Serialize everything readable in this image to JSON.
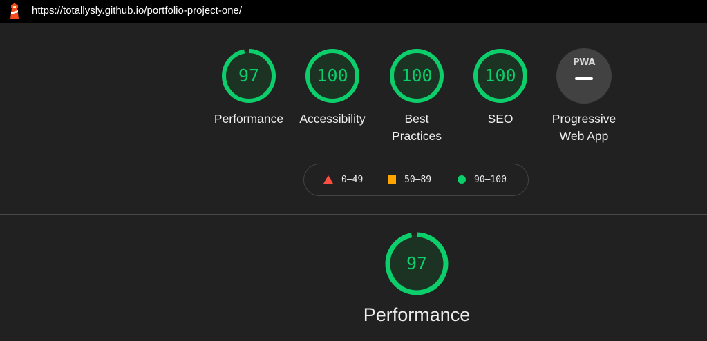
{
  "browser": {
    "url": "https://totallysly.github.io/portfolio-project-one/"
  },
  "colors": {
    "pass": "#0cce6b",
    "average": "#ffa400",
    "fail": "#ff4e42",
    "background": "#212121"
  },
  "gauges": [
    {
      "label": "Performance",
      "score": "97"
    },
    {
      "label": "Accessibility",
      "score": "100"
    },
    {
      "label": "Best Practices",
      "score": "100"
    },
    {
      "label": "SEO",
      "score": "100"
    }
  ],
  "pwa": {
    "badge": "PWA",
    "label": "Progressive Web App"
  },
  "legend": [
    {
      "range": "0–49",
      "icon": "triangle-fail-icon"
    },
    {
      "range": "50–89",
      "icon": "square-average-icon"
    },
    {
      "range": "90–100",
      "icon": "circle-pass-icon"
    }
  ],
  "category": {
    "score": "97",
    "title": "Performance"
  }
}
